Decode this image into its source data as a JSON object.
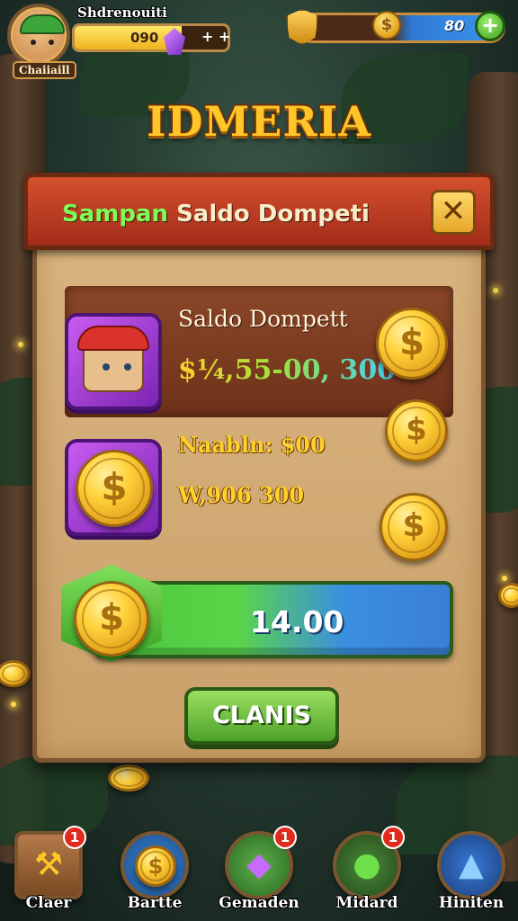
{
  "player": {
    "title": "Shdrenouiti",
    "name_tag": "Chaiiaill",
    "xp_text": "090",
    "xp_plus": "+ +",
    "xp_fraction": 0.7
  },
  "currency": {
    "value": "80",
    "plus_label": "+"
  },
  "game_title": "IDMERIA",
  "dialog": {
    "title_highlight": "Sampan",
    "title_rest": " Saldo Dompeti",
    "close_label": "✕",
    "balance_title": "Saldo Dompett",
    "balance_amount": "$¼,55-00, 300",
    "stat_1": "Naabln: $00",
    "stat_2": "W,906  300",
    "progress_value": "14.00",
    "claim_label": "CLANIS"
  },
  "coin_symbol": "$",
  "nav": [
    {
      "label": "Claer",
      "badge": "1",
      "icon": "broom-icon"
    },
    {
      "label": "Bartte",
      "badge": "",
      "icon": "coin-icon"
    },
    {
      "label": "Gemaden",
      "badge": "1",
      "icon": "gem-icon"
    },
    {
      "label": "Midard",
      "badge": "1",
      "icon": "egg-icon"
    },
    {
      "label": "Hiniten",
      "badge": "",
      "icon": "helmet-icon"
    }
  ],
  "colors": {
    "accent_gold": "#ffc62a",
    "header_red": "#c2402a",
    "claim_green": "#5fb833",
    "gem_purple": "#9c3ad6"
  }
}
